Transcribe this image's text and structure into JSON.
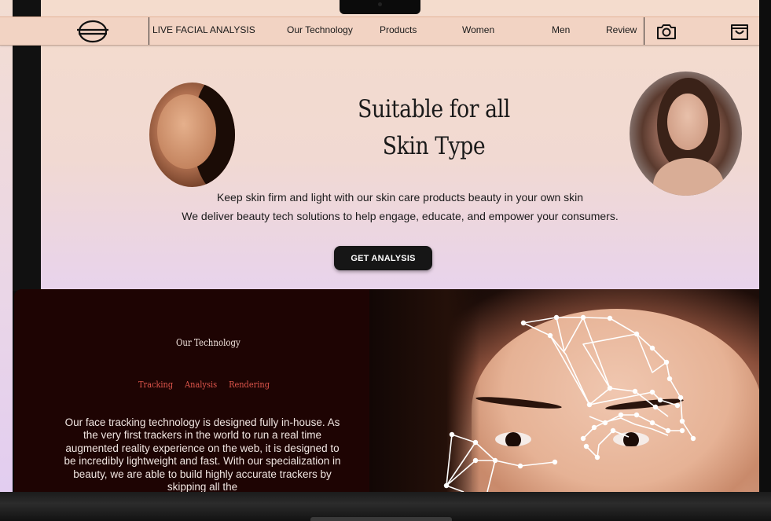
{
  "nav": {
    "logo_icon": "ring-logo-icon",
    "brand_label": "LIVE FACIAL ANALYSIS",
    "links": [
      "Our Technology",
      "Products",
      "Women",
      "Men",
      "Review"
    ],
    "camera_icon": "camera-icon",
    "cart_icon": "shopping-bag-icon"
  },
  "hero": {
    "title_line1": "Suitable  for all",
    "title_line2": "Skin Type",
    "subtitle_line1": "Keep skin  firm and light with our skin care products beauty in your own skin",
    "subtitle_line2": "We deliver beauty tech solutions to help engage, educate, and empower your consumers.",
    "cta_label": "GET ANALYSIS"
  },
  "technology": {
    "heading": "Our Technology",
    "tabs": [
      "Tracking",
      "Analysis",
      "Rendering"
    ],
    "body": "Our face tracking technology is designed fully in-house. As the very first trackers in the world to run a real time augmented reality experience on the web, it is designed to be incredibly lightweight and fast. With our specialization in beauty, we are able to build highly accurate trackers by skipping all the"
  },
  "colors": {
    "hero_bg": "#f4dccd",
    "nav_bg": "#f2d3c3",
    "tech_bg": "#1e0403",
    "tab_accent": "#e0564c",
    "cta_bg": "#161616"
  }
}
